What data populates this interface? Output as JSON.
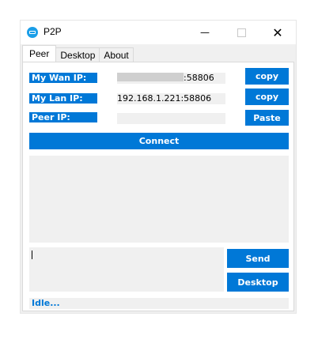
{
  "window": {
    "title": "P2P",
    "minimize_glyph": "—",
    "close_glyph": "✕"
  },
  "tabs": [
    {
      "label": "Peer",
      "active": true
    },
    {
      "label": "Desktop",
      "active": false
    },
    {
      "label": "About",
      "active": false
    }
  ],
  "peer": {
    "wan_label": "My Wan IP:",
    "wan_value_suffix": ":58806",
    "lan_label": "My Lan IP:",
    "lan_value": "192.168.1.221:58806",
    "peer_label": "Peer IP:",
    "peer_value": "",
    "copy_wan_label": "copy",
    "copy_lan_label": "copy",
    "paste_label": "Paste",
    "connect_label": "Connect",
    "send_label": "Send",
    "desktop_label": "Desktop",
    "status": "Idle..."
  },
  "colors": {
    "accent": "#0078d7",
    "field_bg": "#f0f0f0"
  }
}
